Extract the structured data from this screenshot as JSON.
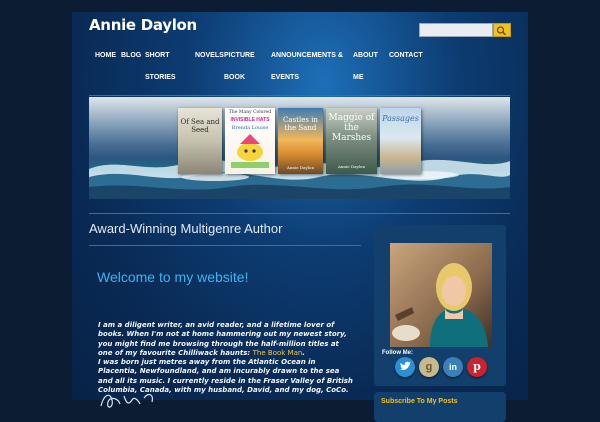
{
  "site": {
    "title": "Annie Daylon"
  },
  "search": {
    "placeholder": ""
  },
  "nav": [
    {
      "label": "HOME"
    },
    {
      "label": "BLOG"
    },
    {
      "label": "SHORT",
      "label2": "STORIES"
    },
    {
      "label": "NOVELS"
    },
    {
      "label": "PICTURE",
      "label2": "BOOK"
    },
    {
      "label": "ANNOUNCEMENTS &",
      "label2": "EVENTS"
    },
    {
      "label": "ABOUT",
      "label2": "ME"
    },
    {
      "label": "CONTACT"
    }
  ],
  "banner": {
    "books": [
      {
        "title": "Of Sea and Seed"
      },
      {
        "title_line1": "The Many Colored",
        "title_line2": "INVISIBLE HATS",
        "author": "Brenda Louise"
      },
      {
        "title": "Castles in the Sand",
        "author": "Annie Daylon"
      },
      {
        "title": "Maggie of the Marshes",
        "author": "Annie Daylon"
      },
      {
        "title": "Passages"
      }
    ]
  },
  "main": {
    "section_title": "Award-Winning Multigenre Author",
    "welcome": "Welcome to my website!",
    "bio_part1": " I am a diligent writer, an avid reader, and a lifetime lover of books. When I'm not at home hammering out my newest story, you might find me browsing through the half-million titles at one of my favourite Chilliwack haunts: ",
    "bio_link": "The Book Man",
    "bio_part2": ".",
    "bio_part3": "I was born just metres away from the Atlantic Ocean in Placentia, Newfoundland, and am incurably drawn to the sea and all its music. I currently reside in the Fraser Valley of British Columbia, Canada, with my husband, David, and my dog, CoCo."
  },
  "sidebar": {
    "follow_label": "Follow Me:",
    "social": [
      {
        "icon": "twitter-bird-icon",
        "color": "#2b8fd4"
      },
      {
        "icon": "goodreads-g-icon",
        "color": "#c7b98e"
      },
      {
        "icon": "linkedin-in-icon",
        "color": "#3a7fb5"
      },
      {
        "icon": "pinterest-p-icon",
        "color": "#c9232d"
      }
    ],
    "subscribe_label": "Subscribe To My Posts"
  },
  "colors": {
    "accent": "#f3c21a",
    "welcome": "#38b5ef",
    "link": "#f1c84a"
  }
}
